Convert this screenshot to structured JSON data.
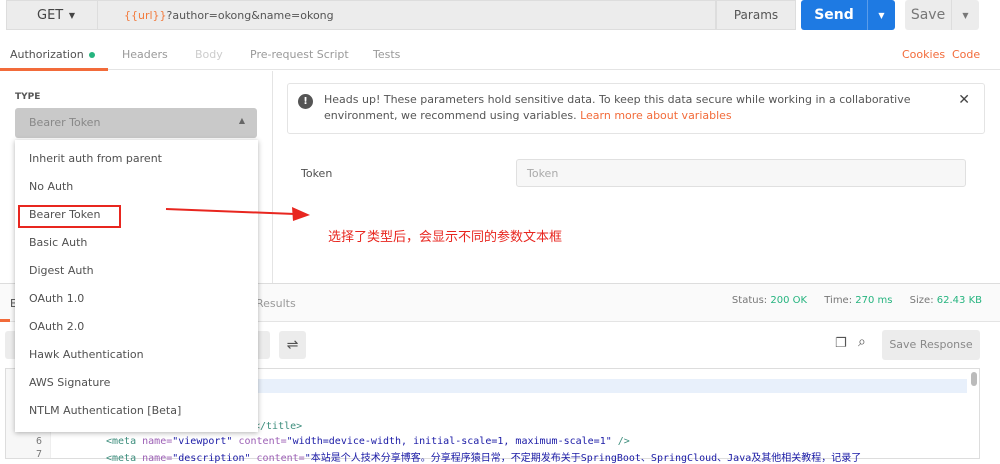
{
  "request": {
    "method": "GET",
    "url_var": "{{url}}",
    "url_rest": "?author=okong&name=okong",
    "params": "Params",
    "send": "Send",
    "save": "Save"
  },
  "tabs": [
    "Authorization",
    "Headers",
    "Body",
    "Pre-request Script",
    "Tests"
  ],
  "links": {
    "cookies": "Cookies",
    "code": "Code"
  },
  "auth": {
    "type_label": "TYPE",
    "selected": "Bearer Token",
    "options": [
      "Inherit auth from parent",
      "No Auth",
      "Bearer Token",
      "Basic Auth",
      "Digest Auth",
      "OAuth 1.0",
      "OAuth 2.0",
      "Hawk Authentication",
      "AWS Signature",
      "NTLM Authentication [Beta]"
    ]
  },
  "alert": {
    "text": "Heads up! These parameters hold sensitive data. To keep this data secure while working in a collaborative environment, we recommend using variables. ",
    "link": "Learn more about variables"
  },
  "token": {
    "label": "Token",
    "placeholder": "Token"
  },
  "annotation": "选择了类型后，会显示不同的参数文本框",
  "response": {
    "tab_partial": "E",
    "results_tab": "Results",
    "status_label": "Status:",
    "status": "200 OK",
    "time_label": "Time:",
    "time": "270 ms",
    "size_label": "Size:",
    "size": "62.43 KB",
    "save_response": "Save Response"
  },
  "code": {
    "line5_tail": "</title>",
    "line6_no": "6",
    "line7_no": "7",
    "line6": {
      "tag": "<meta",
      "a1": " name=",
      "v1": "\"viewport\"",
      "a2": " content=",
      "v2": "\"width=device-width, initial-scale=1, maximum-scale=1\"",
      "end": " />"
    },
    "line7": {
      "tag": "<meta",
      "a1": " name=",
      "v1": "\"description\"",
      "a2": " content=",
      "v2": "\"本站是个人技术分享博客。分享程序猿日常，不定期发布关于SpringBoot、SpringCloud、Java及其他相关教程，记录了"
    }
  }
}
